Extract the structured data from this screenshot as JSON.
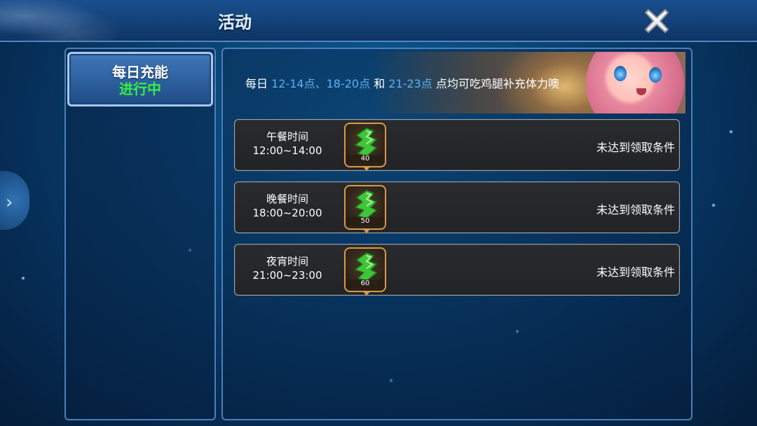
{
  "header": {
    "title": "活动"
  },
  "sidebar": {
    "tabs": [
      {
        "name": "每日充能",
        "status": "进行中"
      }
    ]
  },
  "banner": {
    "prefix": "每日 ",
    "range1": "12-14点",
    "sep": "、",
    "range2": "18-20点",
    "and": " 和 ",
    "range3": "21-23点",
    "suffix": " 点均可吃鸡腿补充体力噢"
  },
  "rewards": [
    {
      "meal": "午餐时间",
      "time": "12:00~14:00",
      "qty": "40",
      "status": "未达到领取条件"
    },
    {
      "meal": "晚餐时间",
      "time": "18:00~20:00",
      "qty": "50",
      "status": "未达到领取条件"
    },
    {
      "meal": "夜宵时间",
      "time": "21:00~23:00",
      "qty": "60",
      "status": "未达到领取条件"
    }
  ],
  "colors": {
    "status_active": "#35ef41",
    "highlight": "#59b2f2",
    "icon_frame": "#d89b4a"
  },
  "icons": {
    "close": "close-x-icon",
    "side_toggle": "chevron-right-icon",
    "reward": "energy-drumstick-icon"
  }
}
